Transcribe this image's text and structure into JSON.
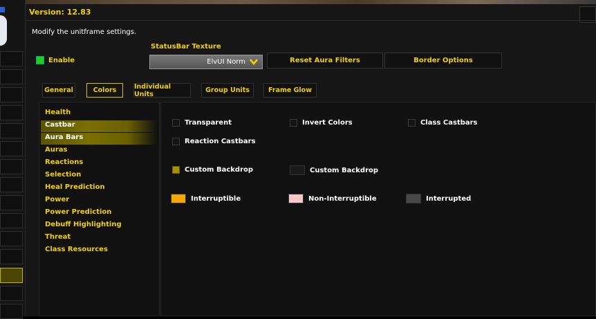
{
  "header": {
    "version": "Version: 12.83",
    "description": "Modify the unitframe settings."
  },
  "enable": {
    "label": "Enable",
    "checked": true
  },
  "statusbar": {
    "label": "StatusBar Texture",
    "value": "ElvUI Norm"
  },
  "buttons": {
    "reset_aura": "Reset Aura Filters",
    "border_options": "Border Options"
  },
  "tabs": [
    {
      "label": "General",
      "active": false
    },
    {
      "label": "Colors",
      "active": true
    },
    {
      "label": "Individual Units",
      "active": false
    },
    {
      "label": "Group Units",
      "active": false
    },
    {
      "label": "Frame Glow",
      "active": false
    }
  ],
  "nav": [
    {
      "label": "Health"
    },
    {
      "label": "Castbar",
      "highlighted": true
    },
    {
      "label": "Aura Bars",
      "highlighted": true
    },
    {
      "label": "Auras"
    },
    {
      "label": "Reactions"
    },
    {
      "label": "Selection"
    },
    {
      "label": "Heal Prediction"
    },
    {
      "label": "Power"
    },
    {
      "label": "Power Prediction"
    },
    {
      "label": "Debuff Highlighting"
    },
    {
      "label": "Threat"
    },
    {
      "label": "Class Resources"
    }
  ],
  "options": {
    "transparent": {
      "label": "Transparent",
      "checked": false
    },
    "invert_colors": {
      "label": "Invert Colors",
      "checked": false
    },
    "class_castbars": {
      "label": "Class Castbars",
      "checked": false
    },
    "reaction_castbars": {
      "label": "Reaction Castbars",
      "checked": false
    },
    "custom_backdrop_toggle": {
      "label": "Custom Backdrop",
      "checked": true
    },
    "custom_backdrop_color": {
      "label": "Custom Backdrop",
      "color": "#1a1a1a"
    }
  },
  "colors": {
    "interruptible": {
      "label": "Interruptible",
      "color": "#f5a800"
    },
    "non_interruptible": {
      "label": "Non-Interruptible",
      "color": "#f8c8c8"
    },
    "interrupted": {
      "label": "Interrupted",
      "color": "#484848"
    }
  },
  "theme": {
    "accent": "#f0d000",
    "highlight": "#7a7000"
  }
}
